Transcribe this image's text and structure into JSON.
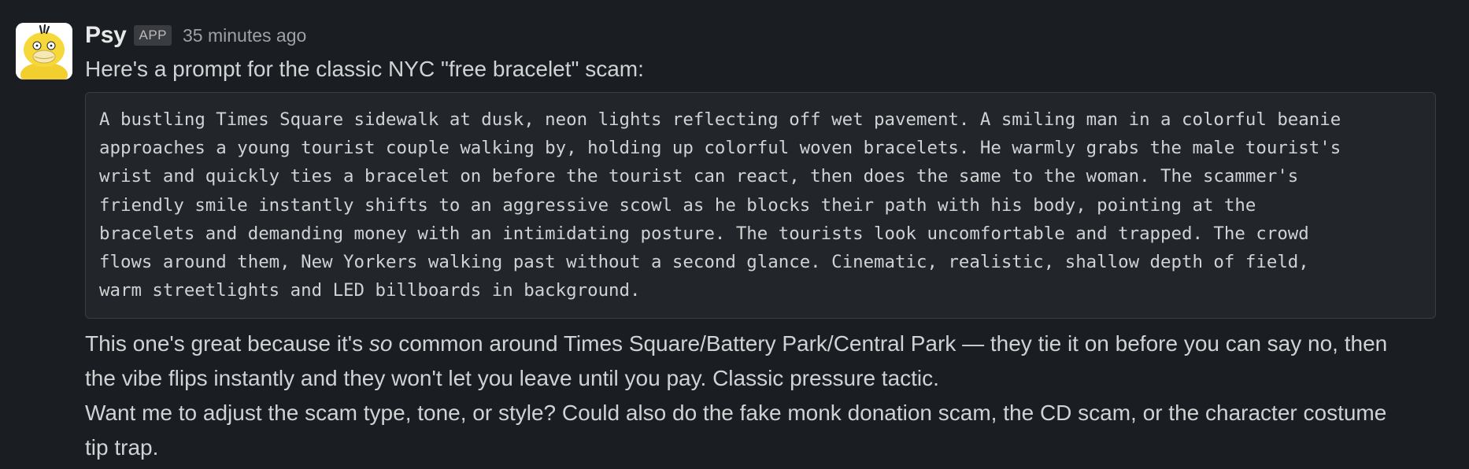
{
  "message": {
    "sender": "Psy",
    "badge": "APP",
    "timestamp": "35 minutes ago",
    "avatar_icon": "psyduck-avatar",
    "intro": "Here's a prompt for the classic NYC \"free bracelet\" scam:",
    "code_lines": [
      "A bustling Times Square sidewalk at dusk, neon lights reflecting off wet pavement. A smiling man in a colorful beanie",
      "approaches a young tourist couple walking by, holding up colorful woven bracelets. He warmly grabs the male tourist's",
      "wrist and quickly ties a bracelet on before the tourist can react, then does the same to the woman. The scammer's",
      "friendly smile instantly shifts to an aggressive scowl as he blocks their path with his body, pointing at the",
      "bracelets and demanding money with an intimidating posture. The tourists look uncomfortable and trapped. The crowd",
      "flows around them, New Yorkers walking past without a second glance. Cinematic, realistic, shallow depth of field,",
      "warm streetlights and LED billboards in background."
    ],
    "para1": {
      "before": "This one's great because it's ",
      "emphasis": "so",
      "after_line1": " common around Times Square/Battery Park/Central Park — they tie it on before you can say no, then",
      "line2": "the vibe flips instantly and they won't let you leave until you pay. Classic pressure tactic."
    },
    "para2": {
      "line1": "Want me to adjust the scam type, tone, or style? Could also do the fake monk donation scam, the CD scam, or the character costume",
      "line2": "tip trap."
    }
  },
  "colors": {
    "background": "#1a1d21",
    "code_background": "#222529",
    "text": "#d1d2d3",
    "avatar_yellow": "#f7d83a"
  }
}
